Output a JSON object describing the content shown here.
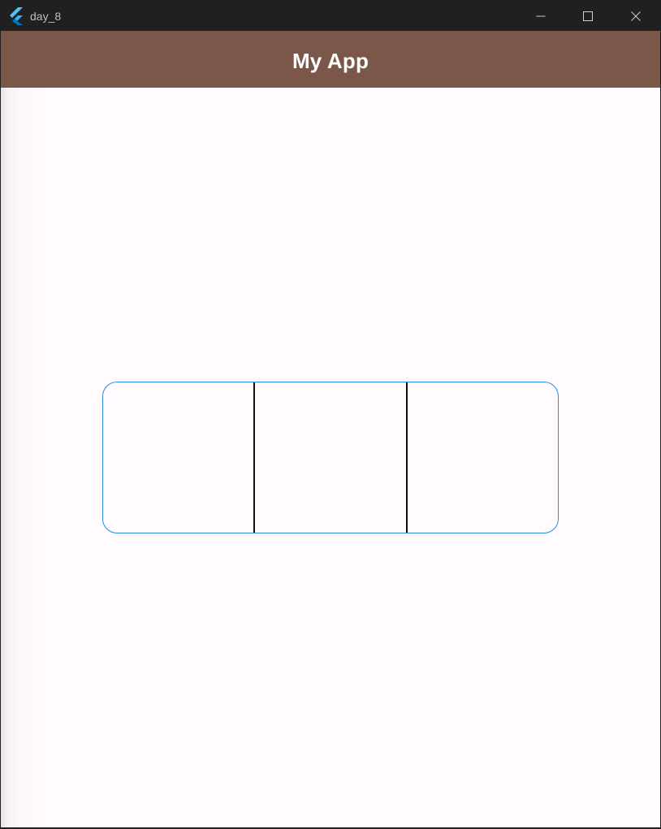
{
  "window": {
    "title": "day_8",
    "icon": "flutter-logo-icon",
    "controls": {
      "minimize_icon": "minimize-icon",
      "maximize_icon": "maximize-icon",
      "close_icon": "close-icon"
    }
  },
  "appbar": {
    "title": "My App",
    "background": "#7b5749",
    "title_color": "#ffffff"
  },
  "content": {
    "background": "#fffbfe",
    "toggle_group": {
      "border_color": "#2c8ed6",
      "divider_color": "#111111",
      "segments": [
        {
          "label": ""
        },
        {
          "label": ""
        },
        {
          "label": ""
        }
      ]
    }
  }
}
